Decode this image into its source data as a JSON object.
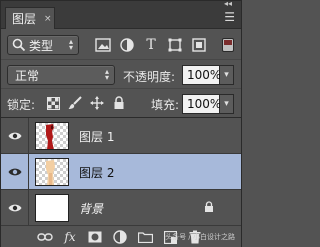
{
  "panel": {
    "tab_label": "图层",
    "tab_close": "×",
    "collapse": "◂◂",
    "menu_glyph": "☰"
  },
  "filter": {
    "kind_label": "类型",
    "icons": [
      "image-filter-icon",
      "adjustment-filter-icon",
      "type-filter-icon",
      "shape-filter-icon",
      "smart-object-filter-icon"
    ],
    "type_glyph": "T"
  },
  "blend": {
    "mode": "正常",
    "opacity_label": "不透明度:",
    "opacity_value": "100%"
  },
  "lock": {
    "label": "锁定:",
    "fill_label": "填充:",
    "fill_value": "100%"
  },
  "layers": [
    {
      "name": "图层 1",
      "visible": true,
      "selected": false,
      "thumb": "red-figure"
    },
    {
      "name": "图层 2",
      "visible": true,
      "selected": true,
      "thumb": "skin-figure"
    },
    {
      "name": "背景",
      "visible": true,
      "selected": false,
      "thumb": "white",
      "locked": true
    }
  ],
  "bottom": {
    "icons": [
      "link-icon",
      "fx-icon",
      "mask-icon",
      "adjustment-icon",
      "folder-icon",
      "new-layer-icon",
      "trash-icon"
    ],
    "fx_label": "fx",
    "watermark": "头条号 / 小白设计之路"
  },
  "colors": {
    "panel_bg": "#535353",
    "selected_row": "#a7b9da",
    "red_figure": "#b01818",
    "skin_figure": "#f3cfa3"
  }
}
